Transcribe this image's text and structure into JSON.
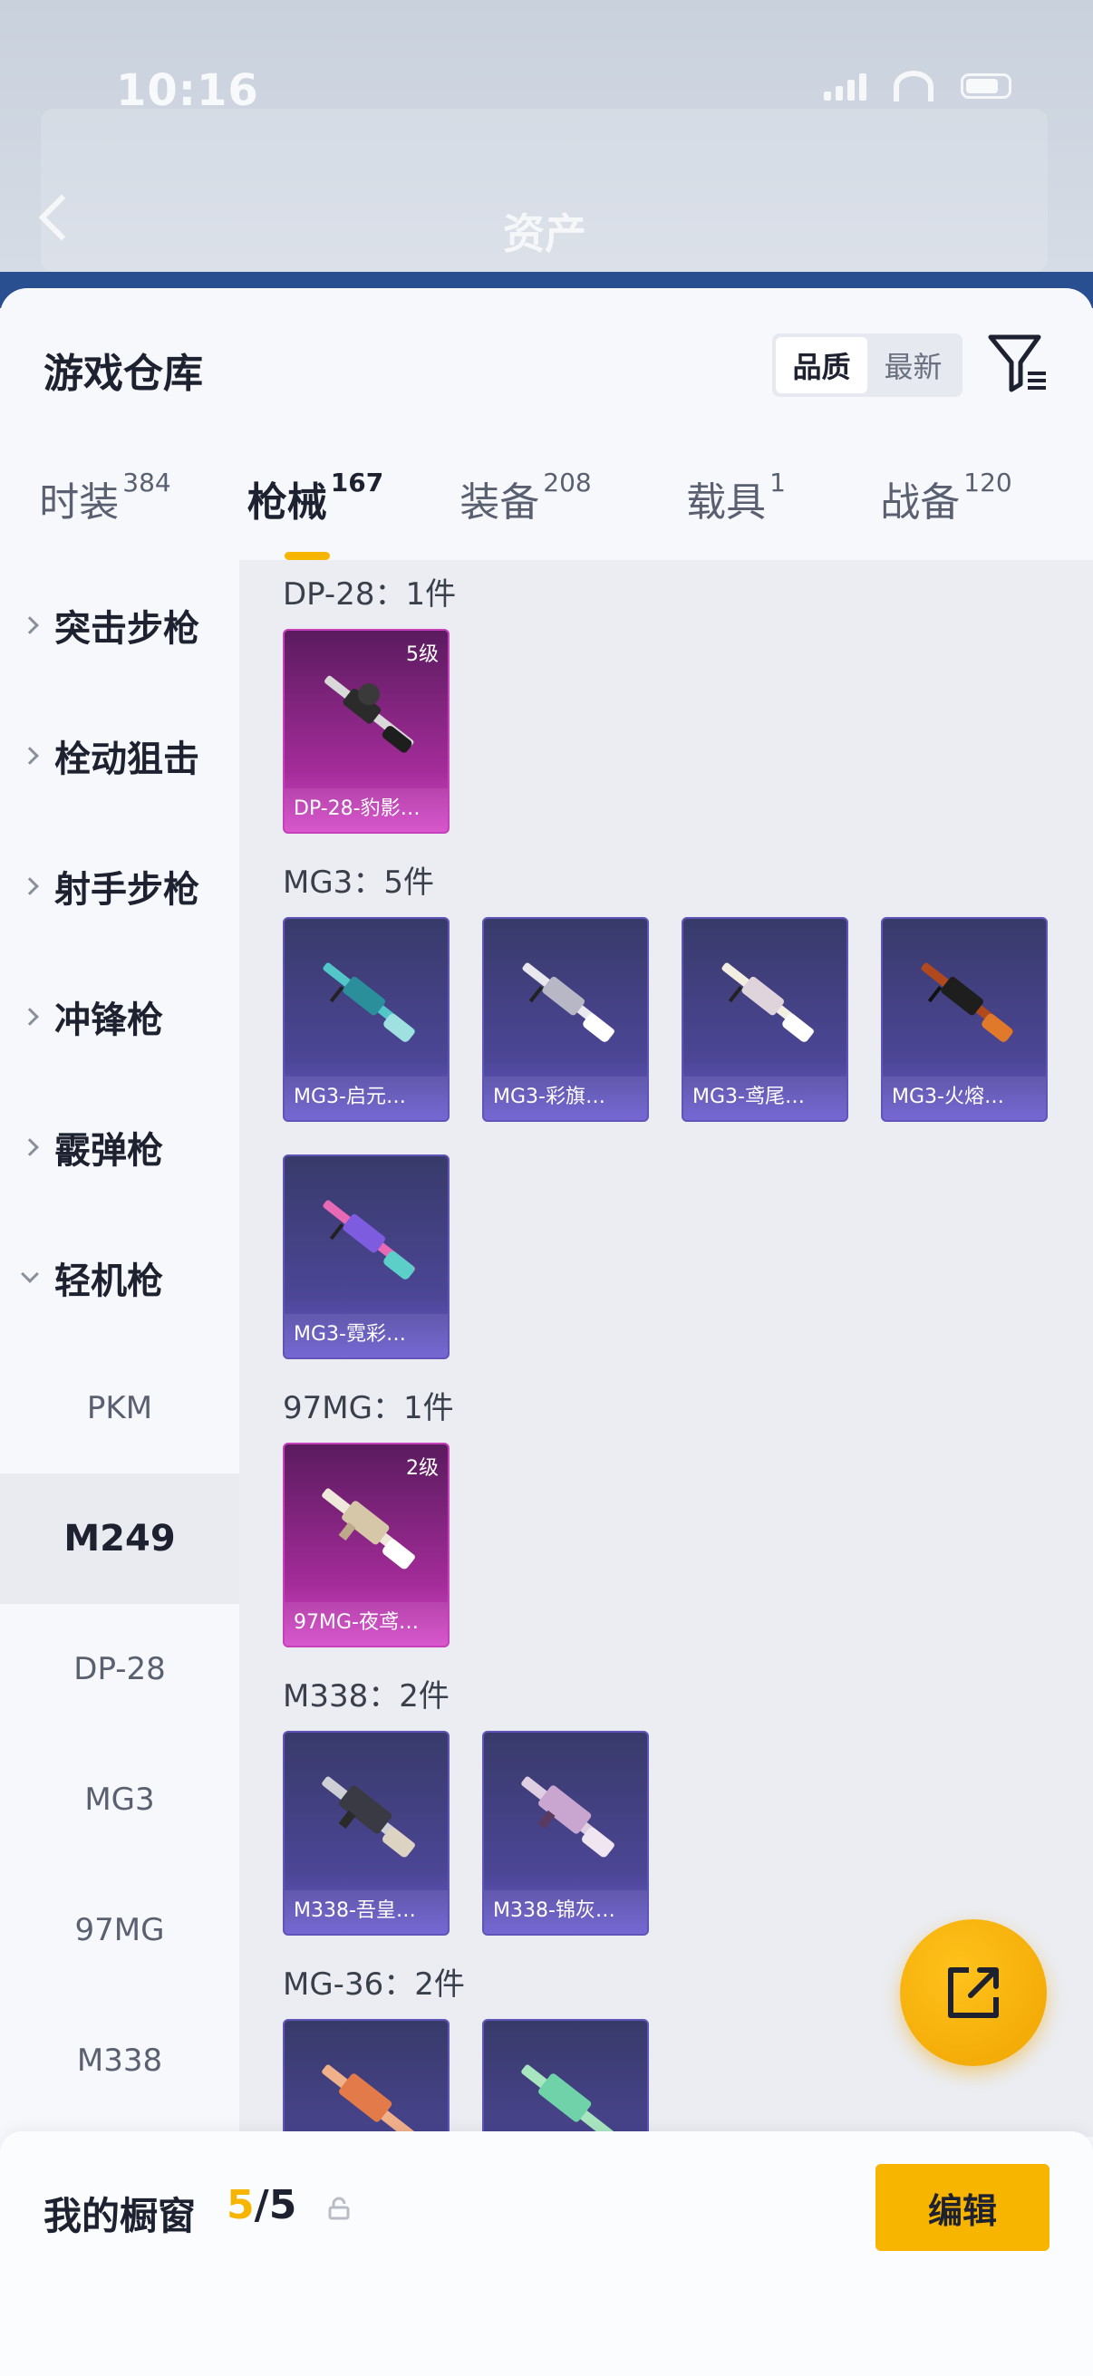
{
  "status_bar": {
    "time": "10:16"
  },
  "background": {
    "title": "资产"
  },
  "sheet": {
    "title": "游戏仓库",
    "sort_options": [
      {
        "label": "品质",
        "active": true
      },
      {
        "label": "最新",
        "active": false
      }
    ],
    "filter_icon": "filter-icon"
  },
  "tabs": [
    {
      "label": "时装",
      "count": "384",
      "active": false
    },
    {
      "label": "枪械",
      "count": "167",
      "active": true
    },
    {
      "label": "装备",
      "count": "208",
      "active": false
    },
    {
      "label": "载具",
      "count": "1",
      "active": false
    },
    {
      "label": "战备",
      "count": "120",
      "active": false
    }
  ],
  "categories": [
    {
      "label": "突击步枪",
      "expanded": false
    },
    {
      "label": "栓动狙击",
      "expanded": false
    },
    {
      "label": "射手步枪",
      "expanded": false
    },
    {
      "label": "冲锋枪",
      "expanded": false
    },
    {
      "label": "霰弹枪",
      "expanded": false
    },
    {
      "label": "轻机枪",
      "expanded": true
    }
  ],
  "subcategories": [
    {
      "label": "PKM",
      "active": false
    },
    {
      "label": "M249",
      "active": true
    },
    {
      "label": "DP-28",
      "active": false
    },
    {
      "label": "MG3",
      "active": false
    },
    {
      "label": "97MG",
      "active": false
    },
    {
      "label": "M338",
      "active": false
    }
  ],
  "groups": [
    {
      "title": "DP-28：1件",
      "items": [
        {
          "name": "DP-28-豹影…",
          "level": "5级",
          "rarity": "pink"
        }
      ]
    },
    {
      "title": "MG3：5件",
      "items": [
        {
          "name": "MG3-启元…",
          "level": "",
          "rarity": "purple"
        },
        {
          "name": "MG3-彩旗…",
          "level": "",
          "rarity": "purple"
        },
        {
          "name": "MG3-鸢尾…",
          "level": "",
          "rarity": "purple"
        },
        {
          "name": "MG3-火熔…",
          "level": "",
          "rarity": "purple"
        },
        {
          "name": "MG3-霓彩…",
          "level": "",
          "rarity": "purple"
        }
      ]
    },
    {
      "title": "97MG：1件",
      "items": [
        {
          "name": "97MG-夜鸢…",
          "level": "2级",
          "rarity": "pink"
        }
      ]
    },
    {
      "title": "M338：2件",
      "items": [
        {
          "name": "M338-吾皇…",
          "level": "",
          "rarity": "purple"
        },
        {
          "name": "M338-锦灰…",
          "level": "",
          "rarity": "purple"
        }
      ]
    },
    {
      "title": "MG-36：2件",
      "items": [
        {
          "name": "",
          "level": "",
          "rarity": "purple"
        },
        {
          "name": "",
          "level": "",
          "rarity": "purple"
        }
      ]
    }
  ],
  "fab": {
    "icon": "share-icon"
  },
  "bottom_bar": {
    "label": "我的橱窗",
    "current": "5",
    "total": "/5",
    "lock_icon": "lock-icon",
    "edit_label": "编辑"
  },
  "colors": {
    "accent": "#f7b500",
    "purple_item": "#4c4696",
    "pink_item": "#a42c9a"
  }
}
